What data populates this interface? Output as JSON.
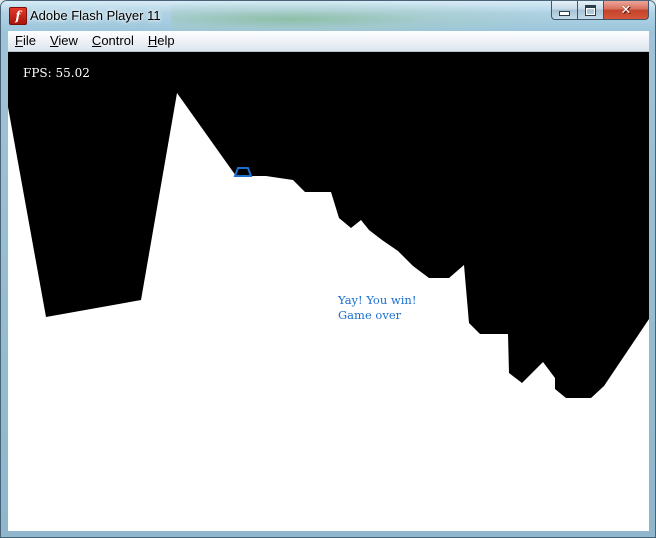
{
  "window": {
    "title": "Adobe Flash Player 11",
    "icon": "flash-player-icon",
    "controls": {
      "minimize_icon": "minimize-icon",
      "maximize_icon": "maximize-icon",
      "close_icon": "close-icon",
      "close_glyph": "✕"
    }
  },
  "menu": {
    "items": [
      {
        "id": "file",
        "label": "File",
        "mnemonic": "F",
        "rest": "ile"
      },
      {
        "id": "view",
        "label": "View",
        "mnemonic": "V",
        "rest": "iew"
      },
      {
        "id": "control",
        "label": "Control",
        "mnemonic": "C",
        "rest": "ontrol"
      },
      {
        "id": "help",
        "label": "Help",
        "mnemonic": "H",
        "rest": "elp"
      }
    ]
  },
  "game": {
    "fps_text": "FPS: 55.02",
    "message_line1": "Yay! You win!",
    "message_line2": "Game over",
    "colors": {
      "sky": "#000000",
      "terrain": "#ffffff",
      "lander": "#1a6fd0",
      "message": "#1a6fd0",
      "fps": "#ffffff"
    }
  }
}
